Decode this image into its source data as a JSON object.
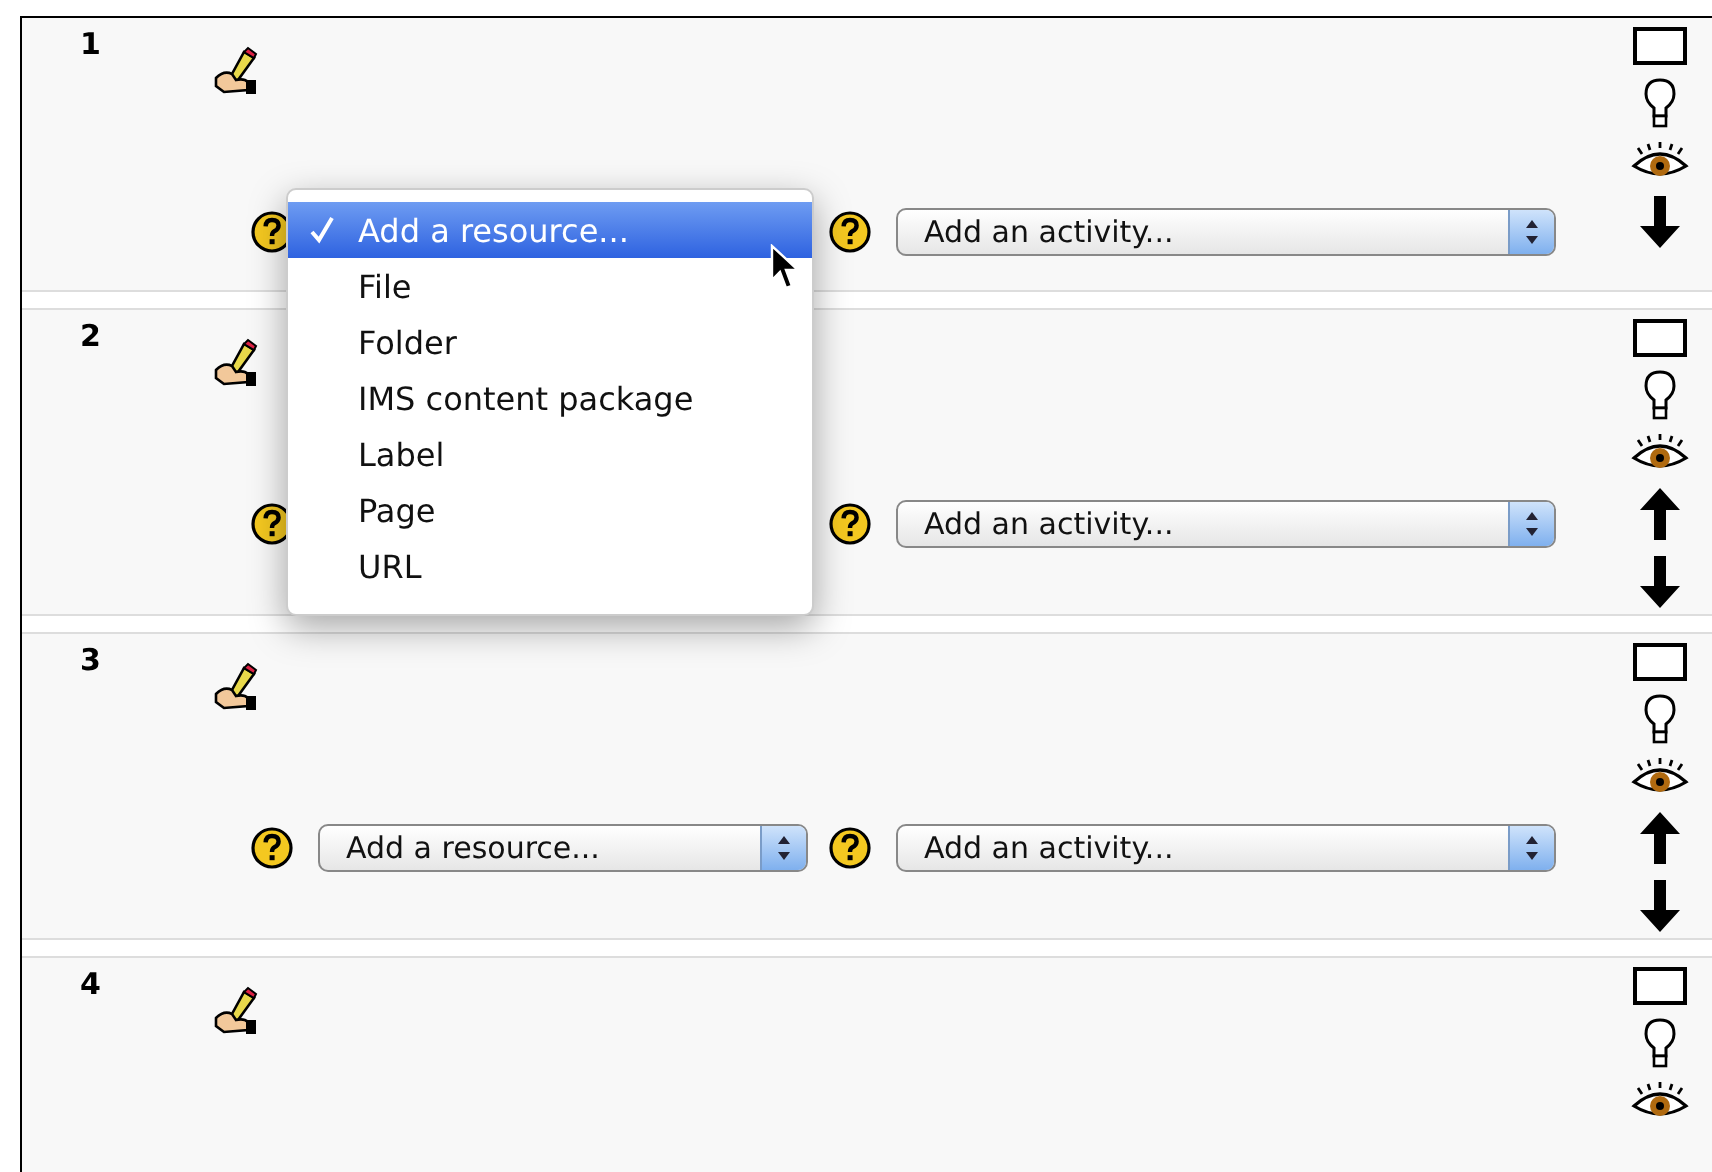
{
  "sections": [
    {
      "number": "1",
      "activity_select": {
        "value": "Add an activity..."
      },
      "move_down": true
    },
    {
      "number": "2",
      "activity_select": {
        "value": "Add an activity..."
      },
      "move_up": true,
      "move_down": true
    },
    {
      "number": "3",
      "resource_select": {
        "value": "Add a resource..."
      },
      "activity_select": {
        "value": "Add an activity..."
      },
      "move_up": true,
      "move_down": true
    },
    {
      "number": "4"
    }
  ],
  "open_menu": {
    "items": [
      {
        "label": "Add a resource...",
        "selected": true
      },
      {
        "label": "File",
        "selected": false
      },
      {
        "label": "Folder",
        "selected": false
      },
      {
        "label": "IMS content package",
        "selected": false
      },
      {
        "label": "Label",
        "selected": false
      },
      {
        "label": "Page",
        "selected": false
      },
      {
        "label": "URL",
        "selected": false
      }
    ]
  }
}
